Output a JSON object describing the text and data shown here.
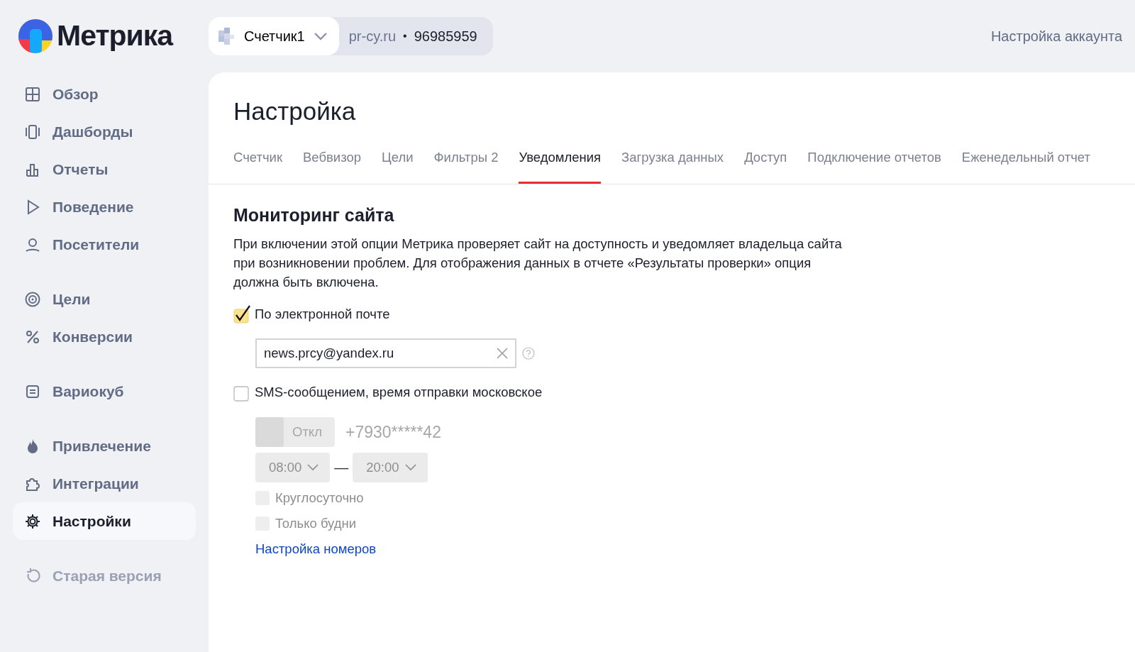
{
  "logo": {
    "text": "Метрика"
  },
  "counter": {
    "name": "Счетчик1",
    "site": "pr-cy.ru",
    "separator": "•",
    "id": "96985959"
  },
  "account_link": "Настройка аккаунта",
  "sidebar": {
    "groups": [
      [
        {
          "label": "Обзор",
          "selected": false
        },
        {
          "label": "Дашборды",
          "selected": false
        },
        {
          "label": "Отчеты",
          "selected": false
        },
        {
          "label": "Поведение",
          "selected": false
        },
        {
          "label": "Посетители",
          "selected": false
        }
      ],
      [
        {
          "label": "Цели",
          "selected": false
        },
        {
          "label": "Конверсии",
          "selected": false
        }
      ],
      [
        {
          "label": "Вариокуб",
          "selected": false
        }
      ],
      [
        {
          "label": "Привлечение",
          "selected": false
        },
        {
          "label": "Интеграции",
          "selected": false
        },
        {
          "label": "Настройки",
          "selected": true
        }
      ]
    ],
    "old_version": "Старая версия"
  },
  "page_title": "Настройка",
  "tabs": [
    {
      "label": "Счетчик",
      "selected": false
    },
    {
      "label": "Вебвизор",
      "selected": false
    },
    {
      "label": "Цели",
      "selected": false
    },
    {
      "label": "Фильтры 2",
      "selected": false
    },
    {
      "label": "Уведомления",
      "selected": true
    },
    {
      "label": "Загрузка данных",
      "selected": false
    },
    {
      "label": "Доступ",
      "selected": false
    },
    {
      "label": "Подключение отчетов",
      "selected": false
    },
    {
      "label": "Еженедельный отчет",
      "selected": false
    }
  ],
  "section": {
    "title": "Мониторинг сайта",
    "description": "При включении этой опции Метрика проверяет сайт на доступность и уведомляет владельца сайта при возникновении проблем. Для отображения данных в отчете «Результаты проверки» опция должна быть включена."
  },
  "email_option": {
    "label": "По электронной почте",
    "checked": true
  },
  "email_field": {
    "value": "news.prcy@yandex.ru"
  },
  "sms_option": {
    "label": "SMS-сообщением, время отправки московское",
    "checked": false
  },
  "sms_settings": {
    "disabled": true,
    "toggle": {
      "label": "Откл",
      "on": false
    },
    "phone": "+7930*****42",
    "time_from": "08:00",
    "dash": "—",
    "time_to": "20:00",
    "options": [
      {
        "label": "Круглосуточно",
        "checked": false
      },
      {
        "label": "Только будни",
        "checked": false
      }
    ],
    "link": "Настройка номеров"
  }
}
